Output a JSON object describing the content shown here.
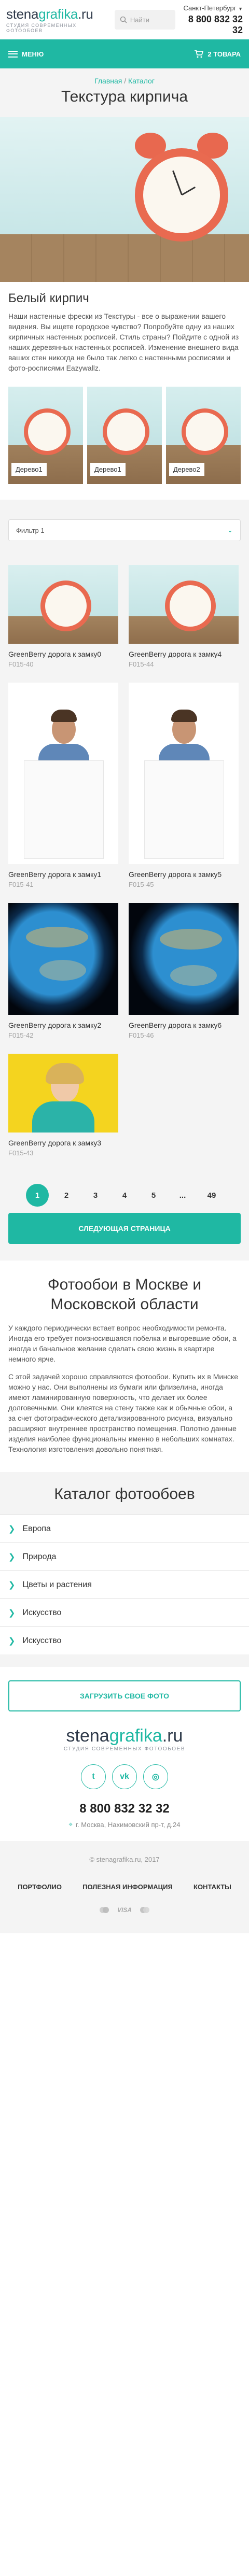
{
  "header": {
    "logo_main": "stena",
    "logo_accent": "grafika",
    "logo_tld": ".ru",
    "logo_sub": "студия современных фотообоев",
    "search_placeholder": "Найти",
    "city": "Санкт-Петербург",
    "phone": "8 800 832 32 32"
  },
  "menubar": {
    "menu_label": "МЕНЮ",
    "cart_label": "2 ТОВАРА"
  },
  "breadcrumb": {
    "home": "Главная",
    "separator": "/",
    "catalog": "Каталог"
  },
  "page_title": "Текстура кирпича",
  "intro": {
    "title": "Белый кирпич",
    "text": "Наши настенные фрески из Текстуры - все о выражении вашего видения. Вы ищете городское чувство? Попробуйте одну из наших кирпичных настенных росписей. Стиль страны? Пойдите с одной из наших деревянных настенных росписей. Изменение внешнего вида ваших стен никогда не было так легко с настенными росписями и фото-росписями Eazywallz."
  },
  "thumbs": [
    "Дерево1",
    "Дерево1",
    "Дерево2"
  ],
  "filter": {
    "selected": "Фильтр 1"
  },
  "products": [
    {
      "name": "GreenBerry дорога к замку0",
      "code": "F015-40"
    },
    {
      "name": "GreenBerry дорога к замку4",
      "code": "F015-44"
    },
    {
      "name": "GreenBerry дорога к замку1",
      "code": "F015-41"
    },
    {
      "name": "GreenBerry дорога к замку5",
      "code": "F015-45"
    },
    {
      "name": "GreenBerry дорога к замку2",
      "code": "F015-42"
    },
    {
      "name": "GreenBerry дорога к замку6",
      "code": "F015-46"
    },
    {
      "name": "GreenBerry дорога к замку3",
      "code": "F015-43"
    }
  ],
  "pagination": {
    "pages": [
      "1",
      "2",
      "3",
      "4",
      "5",
      "...",
      "49"
    ],
    "active": "1"
  },
  "next_page_label": "СЛЕДУЮЩАЯ СТРАНИЦА",
  "seo": {
    "title": "Фотообои в Москве и Московской области",
    "para1": "У каждого периодически встает вопрос необходимости ремонта. Иногда его требует поизносившаяся побелка и выгоревшие обои, а иногда и банальное желание сделать свою жизнь в квартире немного ярче.",
    "para2": "С этой задачей хорошо справляются фотообои. Купить их в Минске можно у нас. Они выполнены из бумаги или флизелина, иногда имеют ламинированную поверхность, что делает их более долговечными. Они клеятся на стену также как и обычные обои, а за счет фотографического детализированного рисунка, визуально расширяют внутреннее пространство помещения. Полотно данные изделия наиболее функциональны именно в небольших комнатах. Технология изготовления довольно понятная."
  },
  "catalog": {
    "title": "Каталог фотообоев",
    "items": [
      "Европа",
      "Природа",
      "Цветы и растения",
      "Искусство",
      "Искусство"
    ]
  },
  "upload_label": "ЗАГРУЗИТЬ СВОЕ ФОТО",
  "footer": {
    "logo_main": "stena",
    "logo_accent": "grafika",
    "logo_tld": ".ru",
    "logo_sub": "студия современных фотообоев",
    "socials": [
      "twitter",
      "vk",
      "instagram"
    ],
    "phone": "8 800 832 32 32",
    "address": "г. Москва, Нахимовский пр-т, д.24",
    "copyright": "© stenagrafika.ru, 2017",
    "nav": [
      "ПОРТФОЛИО",
      "ПОЛЕЗНАЯ ИНФОРМАЦИЯ",
      "КОНТАКТЫ"
    ],
    "payments": [
      "mastercard",
      "VISA",
      "maestro"
    ]
  },
  "colors": {
    "accent": "#1fb8a3",
    "text": "#333333",
    "muted": "#a2a2a2",
    "bg_grey": "#f4f4f4"
  }
}
